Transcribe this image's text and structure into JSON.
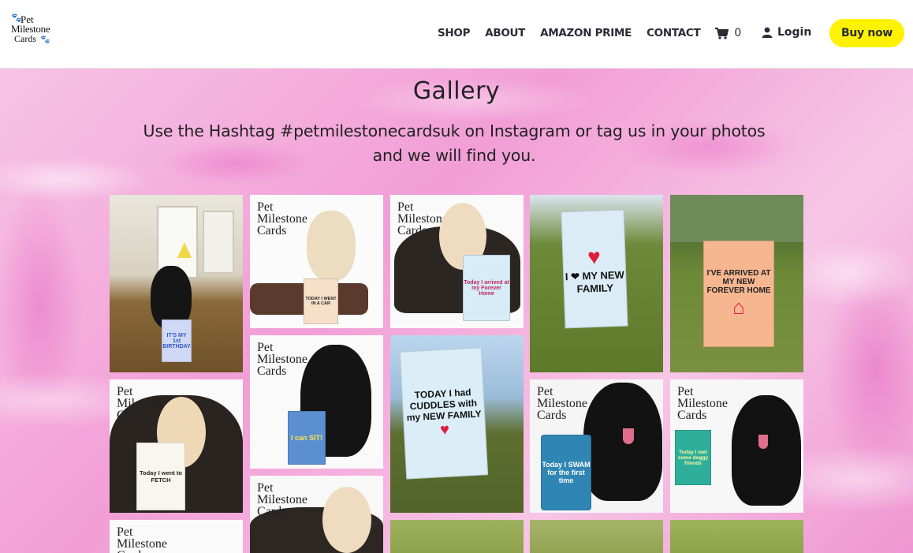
{
  "brand": {
    "line1": "Pet",
    "line2": "Milestone",
    "line3": "Cards"
  },
  "nav": {
    "items": [
      "SHOP",
      "ABOUT",
      "AMAZON PRIME",
      "CONTACT"
    ],
    "cart_count": "0",
    "login_label": "Login",
    "buy_label": "Buy now"
  },
  "page": {
    "title": "Gallery",
    "subtitle_line1": "Use the Hashtag #petmilestonecardsuk on Instagram or tag us in your photos",
    "subtitle_line2": "and we will find you."
  },
  "colors": {
    "accent": "#fff200",
    "background": "#f4b3dc",
    "text": "#222222"
  },
  "tiles": [
    {
      "card": "IT'S MY 1st BIRTHDAY"
    },
    {
      "card": "TODAY I WENT IN A CAR"
    },
    {
      "card": "Today I arrived at my Forever Home"
    },
    {
      "card": "I ❤ MY NEW FAMILY"
    },
    {
      "card": "I'VE ARRIVED AT MY NEW FOREVER HOME"
    },
    {
      "card": "Today I went to FETCH"
    },
    {
      "card": "I can SIT!"
    },
    {
      "card": "TODAY I had CUDDLES with my NEW FAMILY"
    },
    {
      "card": "Today I SWAM for the first time"
    },
    {
      "card": "Today I met some doggy friends"
    }
  ]
}
